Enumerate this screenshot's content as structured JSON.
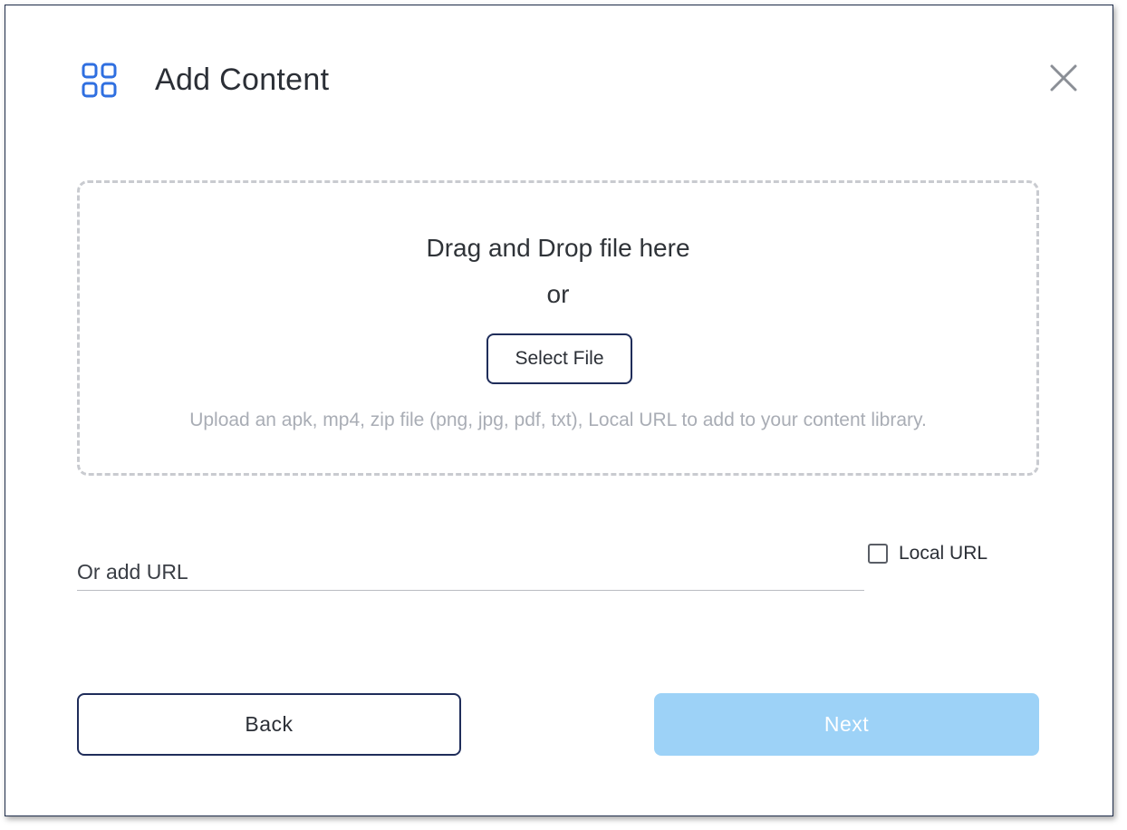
{
  "dialog": {
    "title": "Add Content",
    "icon": "grid-icon",
    "close_icon": "close-icon"
  },
  "dropzone": {
    "title": "Drag and Drop file here",
    "or": "or",
    "select_file_label": "Select File",
    "hint": "Upload an apk, mp4, zip file (png, jpg, pdf, txt), Local URL to add to your content library."
  },
  "url": {
    "placeholder": "Or add URL",
    "value": "",
    "local_url_label": "Local URL",
    "local_url_checked": false
  },
  "footer": {
    "back_label": "Back",
    "next_label": "Next",
    "next_enabled": false
  },
  "colors": {
    "accent_icon": "#2f6fe0",
    "next_disabled_bg": "#9dd2f7",
    "button_border": "#1f2d5a",
    "dropzone_border": "#c9cbd0",
    "hint_text": "#a9adb5"
  }
}
